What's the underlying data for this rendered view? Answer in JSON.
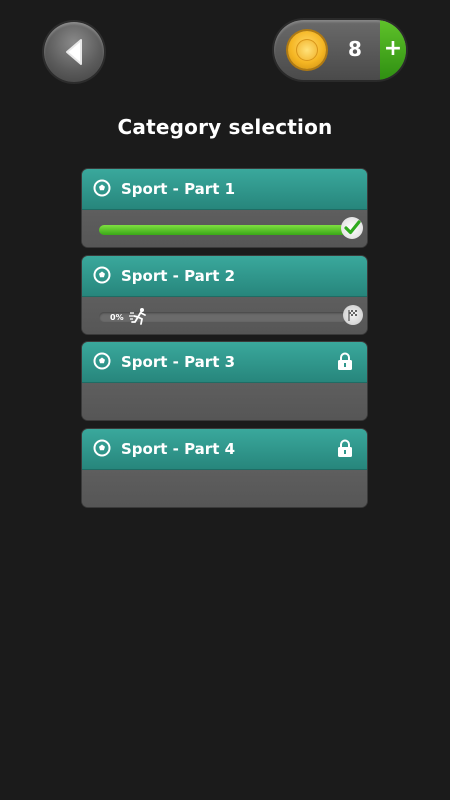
{
  "header": {
    "title": "Category selection",
    "coins": "8",
    "add_label": "+"
  },
  "categories": [
    {
      "label": "Sport - Part 1",
      "status": "completed",
      "progress": 1.0
    },
    {
      "label": "Sport - Part 2",
      "status": "in-progress",
      "progress": 0.0,
      "progress_text": "0%"
    },
    {
      "label": "Sport - Part 3",
      "status": "locked"
    },
    {
      "label": "Sport - Part 4",
      "status": "locked"
    }
  ],
  "icons": {
    "back": "back-arrow-icon",
    "coin": "coin-icon",
    "category": "soccer-ball-icon",
    "lock": "lock-icon",
    "complete": "checkmark-icon",
    "runner": "runner-icon",
    "finish": "finish-flag-icon"
  },
  "colors": {
    "background": "#1b1b1b",
    "header_teal": "#2f978c",
    "progress_green": "#4cc020",
    "coin_gold": "#f5b623"
  }
}
